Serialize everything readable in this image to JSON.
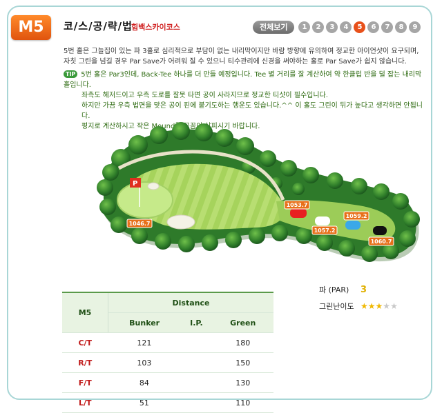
{
  "hole_badge": "M5",
  "title": "코/스/공/략/법",
  "subtitle": "힘백스카이코스",
  "nav": {
    "all_label": "전체보기",
    "holes": [
      "1",
      "2",
      "3",
      "4",
      "5",
      "6",
      "7",
      "8",
      "9"
    ],
    "active_index": 4
  },
  "description": [
    "5번 홀은 그늘집이 있는 파 3홀로 심리적으로 부담이 없는 내리막이지만 바람 방향에 유의하여 정교한 아이언샷이 요구되며,",
    "자칫 그린을 넘길 경우 Par Save가 어려워 질 수 있으니 티수관리에 신경을 써야하는 홀로 Par Save가 쉽지 않습니다."
  ],
  "tip": {
    "badge": "TIP",
    "lines": [
      "5번 홀은 Par3인데, Back-Tee 하나를 더 만들 예정입니다. Tee 별 거리를 잘 계산하여 약 한클럽 반을 덜 잡는 내리막 홀입니다.",
      "좌측도 헤저드이고 우측 도로를 잘못 타면 공이 사라지므로 정교한 티샷이 필수입니다.",
      "하지만 가끔 우측 법면을 맞은 공이 핀에 붙기도하는 행운도 있습니다.^^ 이 홀도 그린이 뒤가 높다고 생각하면 안됩니다.",
      "평지로 계산하시고 작은 Mound를 꼼꼼이 살피시기 바랍니다."
    ]
  },
  "map": {
    "flag_label": "P",
    "markers": [
      "1046.7",
      "1053.7",
      "1057.2",
      "1059.2",
      "1060.7"
    ]
  },
  "info": {
    "par_label": "파 (PAR)",
    "par_value": "3",
    "difficulty_label": "그린난이도",
    "difficulty": 3,
    "difficulty_max": 5
  },
  "distance_table": {
    "hole": "M5",
    "group_header": "Distance",
    "columns": [
      "Bunker",
      "I.P.",
      "Green"
    ],
    "rows": [
      {
        "tee": "C/T",
        "bunker": "121",
        "ip": "",
        "green": "180"
      },
      {
        "tee": "R/T",
        "bunker": "103",
        "ip": "",
        "green": "150"
      },
      {
        "tee": "F/T",
        "bunker": "84",
        "ip": "",
        "green": "130"
      },
      {
        "tee": "L/T",
        "bunker": "51",
        "ip": "",
        "green": "110"
      }
    ]
  },
  "colors": {
    "accent": "#e8501a",
    "frame": "#a8d6d6",
    "tip_text": "#2d6a10",
    "table_header_bg": "#e8f3e2"
  }
}
